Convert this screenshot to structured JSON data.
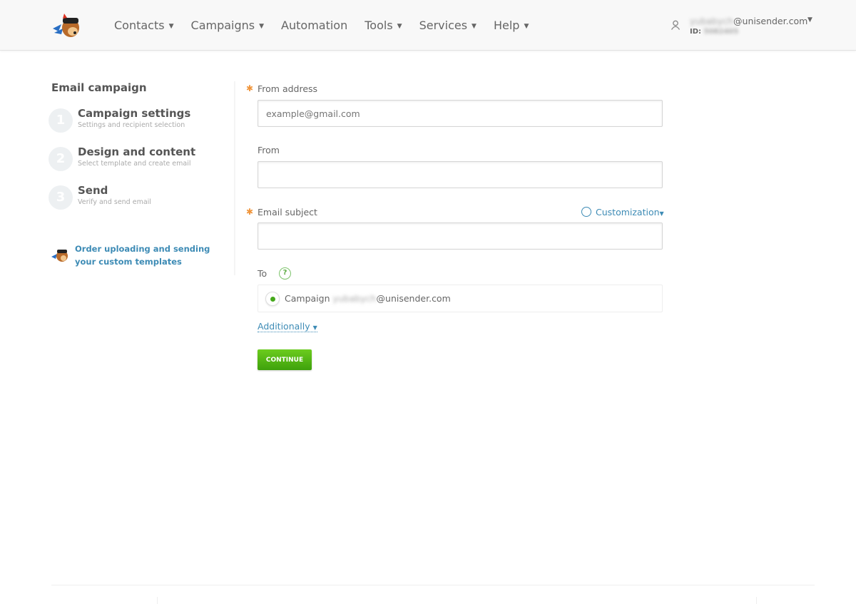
{
  "header": {
    "nav": [
      {
        "label": "Contacts",
        "dropdown": true
      },
      {
        "label": "Campaigns",
        "dropdown": true
      },
      {
        "label": "Automation",
        "dropdown": false
      },
      {
        "label": "Tools",
        "dropdown": true
      },
      {
        "label": "Services",
        "dropdown": true
      },
      {
        "label": "Help",
        "dropdown": true
      }
    ],
    "user": {
      "name_blurred": "yubabych",
      "domain": "@unisender.com",
      "id_label": "ID:",
      "id_blurred": "5082405"
    }
  },
  "sidebar": {
    "title": "Email campaign",
    "steps": [
      {
        "num": "1",
        "title": "Campaign settings",
        "subtitle": "Settings and recipient selection"
      },
      {
        "num": "2",
        "title": "Design and content",
        "subtitle": "Select template and create email"
      },
      {
        "num": "3",
        "title": "Send",
        "subtitle": "Verify and send email"
      }
    ],
    "order_link": "Order uploading and sending your custom templates"
  },
  "form": {
    "from_address": {
      "label": "From address",
      "placeholder": "example@gmail.com",
      "value": ""
    },
    "from": {
      "label": "From",
      "value": ""
    },
    "subject": {
      "label": "Email subject",
      "value": ""
    },
    "customization": "Customization",
    "to": {
      "label": "To",
      "help": "?",
      "option_prefix": "Campaign",
      "option_name_blurred": "yubabych",
      "option_domain": "@unisender.com"
    },
    "additionally": "Additionally",
    "continue": "CONTINUE"
  },
  "colors": {
    "accent": "#3d8bb5",
    "green": "#45a81b",
    "required": "#f0953b"
  }
}
